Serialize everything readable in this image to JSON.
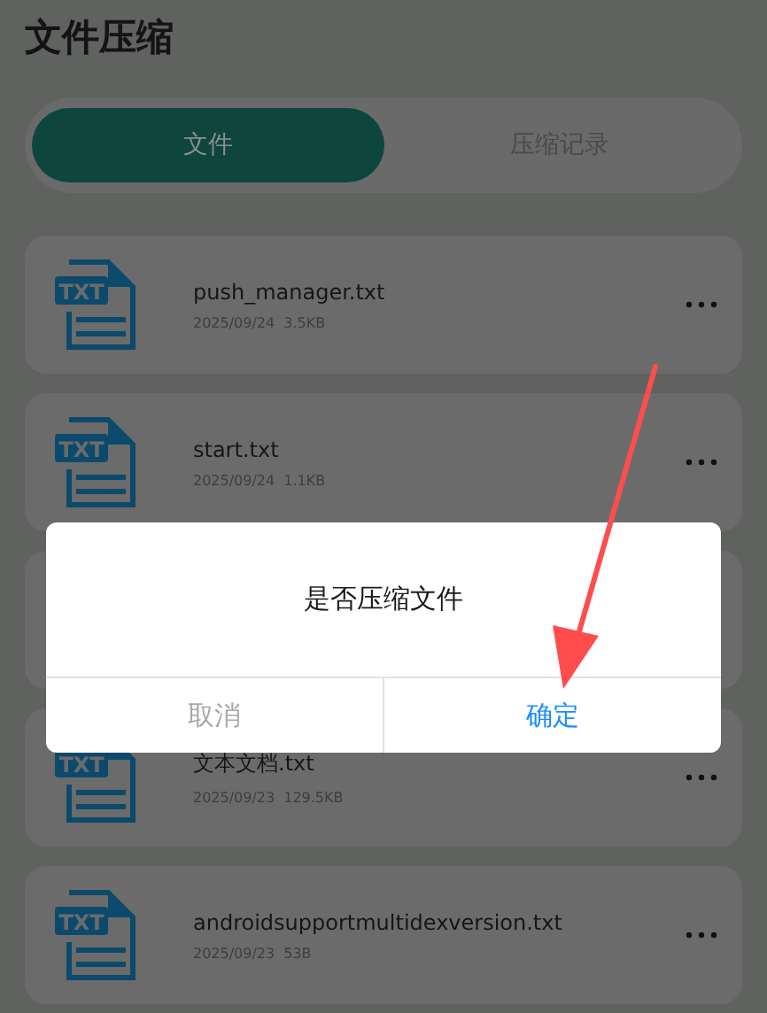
{
  "title": "文件压缩",
  "tabs": [
    {
      "label": "文件",
      "selected": true
    },
    {
      "label": "压缩记录",
      "selected": false
    }
  ],
  "files": [
    {
      "icon_label": "TXT",
      "name": "push_manager.txt",
      "date": "2025/09/24",
      "size": "3.5KB"
    },
    {
      "icon_label": "TXT",
      "name": "start.txt",
      "date": "2025/09/24",
      "size": "1.1KB"
    },
    {
      "icon_label": "TXT",
      "name": "文本文档.txt",
      "date": "2025/09/23",
      "size": "129.5KB"
    },
    {
      "icon_label": "TXT",
      "name": "androidsupportmultidexversion.txt",
      "date": "2025/09/23",
      "size": "53B"
    }
  ],
  "dialog": {
    "message": "是否压缩文件",
    "buttons": [
      {
        "label": "取消",
        "kind": "cancel"
      },
      {
        "label": "确定",
        "kind": "confirm"
      }
    ]
  }
}
